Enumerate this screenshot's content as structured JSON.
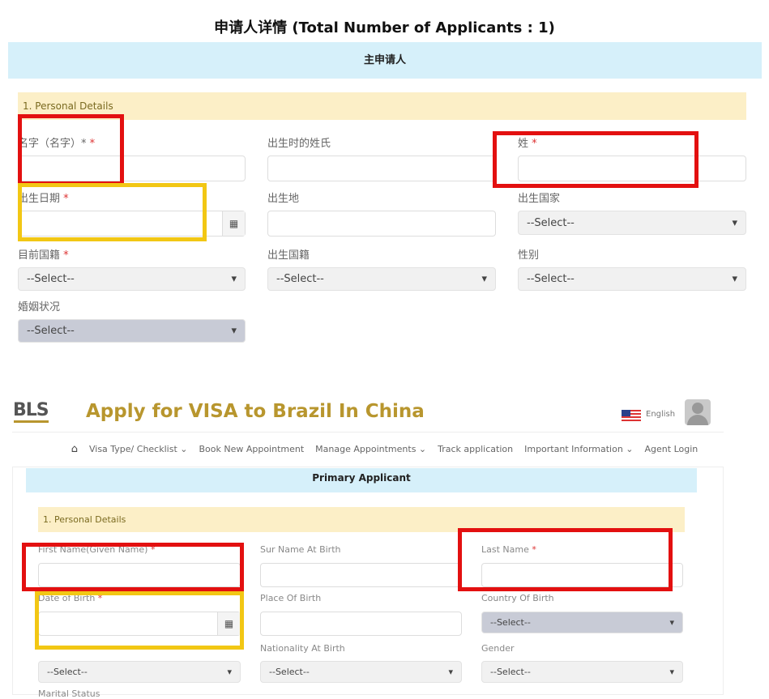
{
  "zh": {
    "heading": "申请人详情 (Total Number of Applicants : 1)",
    "primary": "主申请人",
    "section": "1. Personal Details",
    "fields": [
      {
        "label": "名字（名字）*",
        "req": " *"
      },
      {
        "label": "出生时的姓氏",
        "req": ""
      },
      {
        "label": "姓",
        "req": " *"
      },
      {
        "label": "出生日期",
        "req": " *"
      },
      {
        "label": "出生地",
        "req": ""
      },
      {
        "label": "出生国家",
        "req": "",
        "value": "--Select--"
      },
      {
        "label": "目前国籍",
        "req": " *",
        "value": "--Select--"
      },
      {
        "label": "出生国籍",
        "req": "",
        "value": "--Select--"
      },
      {
        "label": "性别",
        "req": "",
        "value": "--Select--"
      },
      {
        "label": "婚姻状况",
        "req": "",
        "value": "--Select--"
      }
    ]
  },
  "en": {
    "logo": "BLS",
    "site_title": "Apply for VISA to Brazil In China",
    "language": "English",
    "nav": [
      "Visa Type/ Checklist ⌄",
      "Book New Appointment",
      "Manage Appointments ⌄",
      "Track application",
      "Important Information ⌄",
      "Agent Login"
    ],
    "primary": "Primary Applicant",
    "section": "1. Personal Details",
    "fields": [
      {
        "label": "First Name(Given Name)",
        "req": " *"
      },
      {
        "label": "Sur Name At Birth",
        "req": ""
      },
      {
        "label": "Last Name",
        "req": " *"
      },
      {
        "label": "Date of Birth",
        "req": " *"
      },
      {
        "label": "Place Of Birth",
        "req": ""
      },
      {
        "label": "Country Of Birth",
        "req": "",
        "value": "--Select--"
      },
      {
        "label": "Nationality At Birth",
        "req": "",
        "value": "--Select--"
      },
      {
        "label": "Gender",
        "req": "",
        "value": "--Select--"
      },
      {
        "label": "Marital Status",
        "req": ""
      }
    ],
    "current_nationality_value": "--Select--",
    "nationality_at_birth_value": "--Select--",
    "gender_value": "--Select--"
  },
  "colors": {
    "highlight_red": "#e31010",
    "highlight_yellow": "#f2c714",
    "brand_gold": "#b8962e"
  }
}
